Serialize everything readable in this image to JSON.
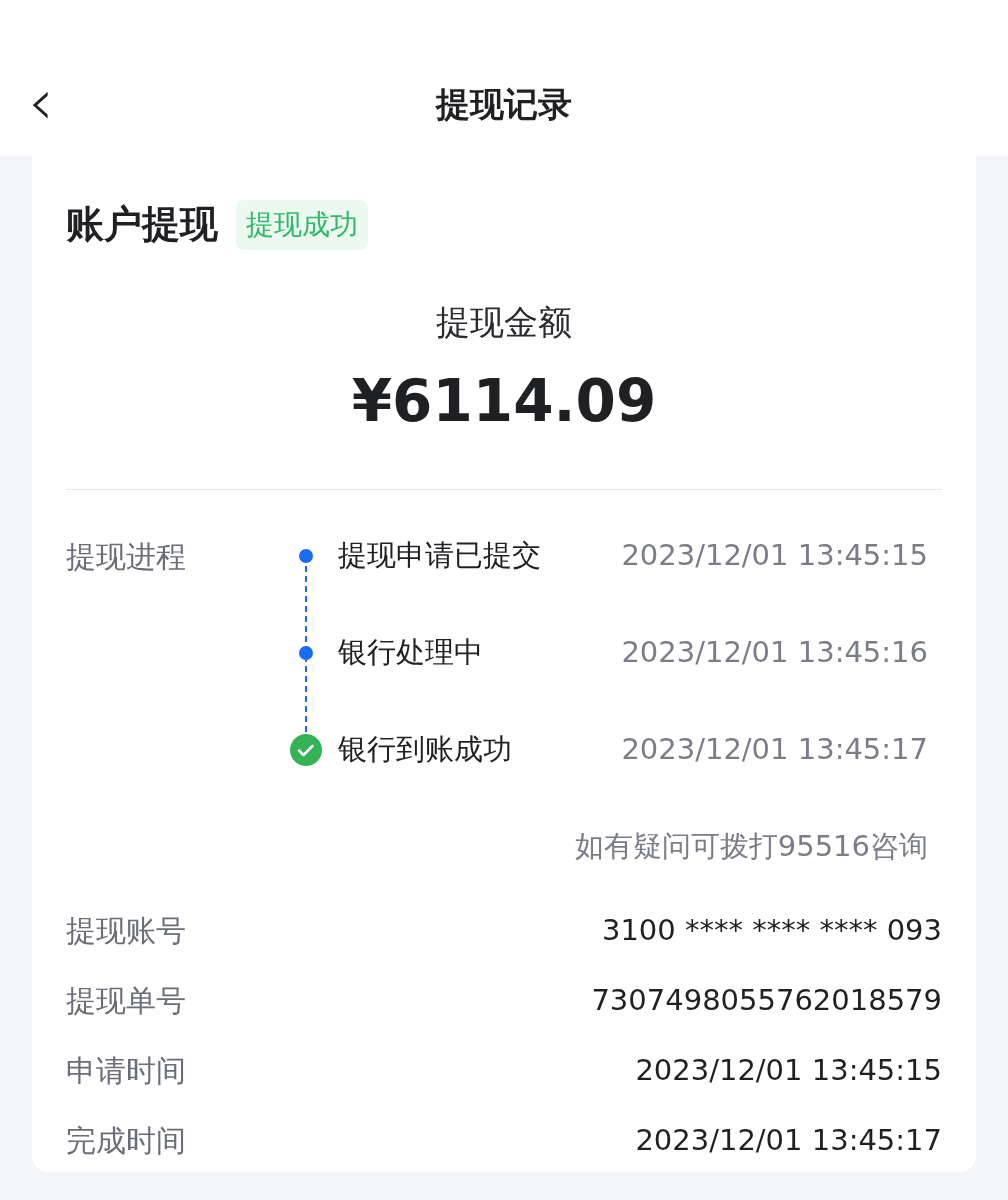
{
  "header": {
    "back": "‹",
    "title": "提现记录"
  },
  "card": {
    "title": "账户提现",
    "status": "提现成功",
    "amount_label": "提现金额",
    "amount": "¥6114.09",
    "progress": {
      "label": "提现进程",
      "steps": [
        {
          "kind": "dot",
          "text": "提现申请已提交",
          "time": "2023/12/01 13:45:15"
        },
        {
          "kind": "dot",
          "text": "银行处理中",
          "time": "2023/12/01 13:45:16"
        },
        {
          "kind": "check",
          "text": "银行到账成功",
          "time": "2023/12/01 13:45:17"
        }
      ],
      "note": "如有疑问可拨打95516咨询"
    },
    "details": [
      {
        "label": "提现账号",
        "value": "3100 **** **** **** 093"
      },
      {
        "label": "提现单号",
        "value": "7307498055762018579"
      },
      {
        "label": "申请时间",
        "value": "2023/12/01 13:45:15"
      },
      {
        "label": "完成时间",
        "value": "2023/12/01 13:45:17"
      }
    ]
  }
}
